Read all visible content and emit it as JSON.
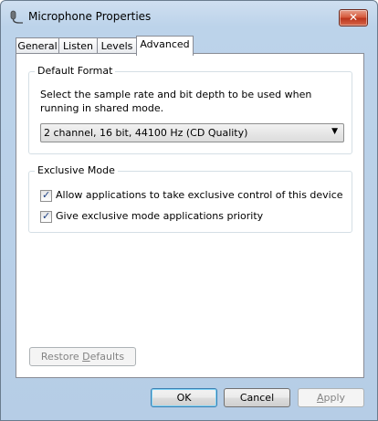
{
  "window": {
    "title": "Microphone Properties",
    "close_symbol": "✕"
  },
  "tabs": [
    {
      "label": "General"
    },
    {
      "label": "Listen"
    },
    {
      "label": "Levels"
    },
    {
      "label": "Advanced",
      "active": true
    }
  ],
  "default_format": {
    "group_label": "Default Format",
    "description": "Select the sample rate and bit depth to be used when running in shared mode.",
    "selected_value": "2 channel, 16 bit, 44100 Hz (CD Quality)"
  },
  "exclusive_mode": {
    "group_label": "Exclusive Mode",
    "options": [
      {
        "label": "Allow applications to take exclusive control of this device",
        "checked": true
      },
      {
        "label": "Give exclusive mode applications priority",
        "checked": true
      }
    ]
  },
  "buttons": {
    "restore_defaults_pre": "Restore ",
    "restore_defaults_u": "D",
    "restore_defaults_post": "efaults",
    "ok": "OK",
    "cancel_pre": "",
    "cancel_u": "",
    "cancel": "Cancel",
    "apply_u": "A",
    "apply_post": "pply"
  },
  "colors": {
    "frame": "#b6cde6",
    "close_button": "#c8452a"
  },
  "icons": {
    "title": "microphone-icon",
    "close": "close-icon",
    "dropdown": "chevron-down-icon",
    "check": "checkmark-icon"
  }
}
